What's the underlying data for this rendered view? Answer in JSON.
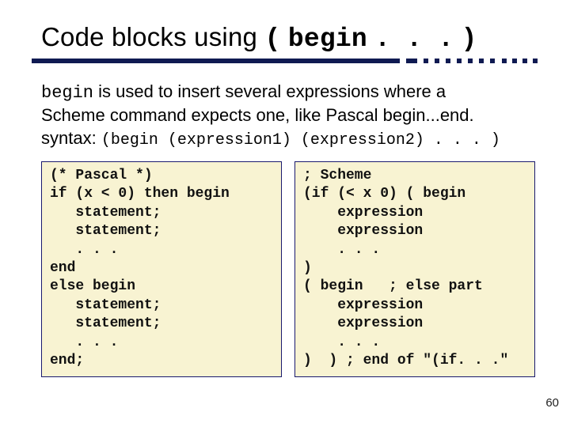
{
  "title": {
    "prefix": "Code blocks using",
    "paren_open": "(",
    "keyword": "begin",
    "dots": ". . .",
    "paren_close": ")"
  },
  "intro": {
    "keyword": "begin",
    "rest1": " is used to insert several expressions where a",
    "line2": "Scheme command expects one, like Pascal begin...end.",
    "syntax_label": "syntax:",
    "syntax_code": "(begin (expression1) (expression2) . . . )"
  },
  "code_left": "(* Pascal *)\nif (x < 0) then begin\n   statement;\n   statement;\n   . . .\nend\nelse begin\n   statement;\n   statement;\n   . . .\nend;",
  "code_right": "; Scheme\n(if (< x 0) ( begin\n    expression\n    expression\n    . . .\n)\n( begin   ; else part\n    expression\n    expression\n    . . .\n)  ) ; end of \"(if. . .\"",
  "page_number": "60"
}
